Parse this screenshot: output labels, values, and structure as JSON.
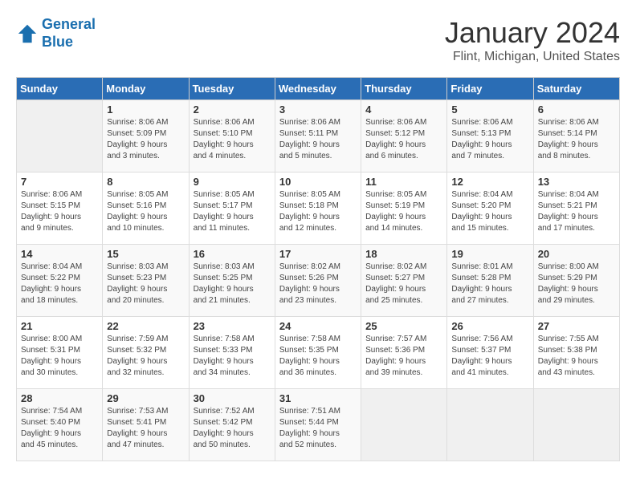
{
  "logo": {
    "text_general": "General",
    "text_blue": "Blue"
  },
  "header": {
    "title": "January 2024",
    "subtitle": "Flint, Michigan, United States"
  },
  "weekdays": [
    "Sunday",
    "Monday",
    "Tuesday",
    "Wednesday",
    "Thursday",
    "Friday",
    "Saturday"
  ],
  "weeks": [
    [
      {
        "day": "",
        "info": ""
      },
      {
        "day": "1",
        "info": "Sunrise: 8:06 AM\nSunset: 5:09 PM\nDaylight: 9 hours\nand 3 minutes."
      },
      {
        "day": "2",
        "info": "Sunrise: 8:06 AM\nSunset: 5:10 PM\nDaylight: 9 hours\nand 4 minutes."
      },
      {
        "day": "3",
        "info": "Sunrise: 8:06 AM\nSunset: 5:11 PM\nDaylight: 9 hours\nand 5 minutes."
      },
      {
        "day": "4",
        "info": "Sunrise: 8:06 AM\nSunset: 5:12 PM\nDaylight: 9 hours\nand 6 minutes."
      },
      {
        "day": "5",
        "info": "Sunrise: 8:06 AM\nSunset: 5:13 PM\nDaylight: 9 hours\nand 7 minutes."
      },
      {
        "day": "6",
        "info": "Sunrise: 8:06 AM\nSunset: 5:14 PM\nDaylight: 9 hours\nand 8 minutes."
      }
    ],
    [
      {
        "day": "7",
        "info": "Sunrise: 8:06 AM\nSunset: 5:15 PM\nDaylight: 9 hours\nand 9 minutes."
      },
      {
        "day": "8",
        "info": "Sunrise: 8:05 AM\nSunset: 5:16 PM\nDaylight: 9 hours\nand 10 minutes."
      },
      {
        "day": "9",
        "info": "Sunrise: 8:05 AM\nSunset: 5:17 PM\nDaylight: 9 hours\nand 11 minutes."
      },
      {
        "day": "10",
        "info": "Sunrise: 8:05 AM\nSunset: 5:18 PM\nDaylight: 9 hours\nand 12 minutes."
      },
      {
        "day": "11",
        "info": "Sunrise: 8:05 AM\nSunset: 5:19 PM\nDaylight: 9 hours\nand 14 minutes."
      },
      {
        "day": "12",
        "info": "Sunrise: 8:04 AM\nSunset: 5:20 PM\nDaylight: 9 hours\nand 15 minutes."
      },
      {
        "day": "13",
        "info": "Sunrise: 8:04 AM\nSunset: 5:21 PM\nDaylight: 9 hours\nand 17 minutes."
      }
    ],
    [
      {
        "day": "14",
        "info": "Sunrise: 8:04 AM\nSunset: 5:22 PM\nDaylight: 9 hours\nand 18 minutes."
      },
      {
        "day": "15",
        "info": "Sunrise: 8:03 AM\nSunset: 5:23 PM\nDaylight: 9 hours\nand 20 minutes."
      },
      {
        "day": "16",
        "info": "Sunrise: 8:03 AM\nSunset: 5:25 PM\nDaylight: 9 hours\nand 21 minutes."
      },
      {
        "day": "17",
        "info": "Sunrise: 8:02 AM\nSunset: 5:26 PM\nDaylight: 9 hours\nand 23 minutes."
      },
      {
        "day": "18",
        "info": "Sunrise: 8:02 AM\nSunset: 5:27 PM\nDaylight: 9 hours\nand 25 minutes."
      },
      {
        "day": "19",
        "info": "Sunrise: 8:01 AM\nSunset: 5:28 PM\nDaylight: 9 hours\nand 27 minutes."
      },
      {
        "day": "20",
        "info": "Sunrise: 8:00 AM\nSunset: 5:29 PM\nDaylight: 9 hours\nand 29 minutes."
      }
    ],
    [
      {
        "day": "21",
        "info": "Sunrise: 8:00 AM\nSunset: 5:31 PM\nDaylight: 9 hours\nand 30 minutes."
      },
      {
        "day": "22",
        "info": "Sunrise: 7:59 AM\nSunset: 5:32 PM\nDaylight: 9 hours\nand 32 minutes."
      },
      {
        "day": "23",
        "info": "Sunrise: 7:58 AM\nSunset: 5:33 PM\nDaylight: 9 hours\nand 34 minutes."
      },
      {
        "day": "24",
        "info": "Sunrise: 7:58 AM\nSunset: 5:35 PM\nDaylight: 9 hours\nand 36 minutes."
      },
      {
        "day": "25",
        "info": "Sunrise: 7:57 AM\nSunset: 5:36 PM\nDaylight: 9 hours\nand 39 minutes."
      },
      {
        "day": "26",
        "info": "Sunrise: 7:56 AM\nSunset: 5:37 PM\nDaylight: 9 hours\nand 41 minutes."
      },
      {
        "day": "27",
        "info": "Sunrise: 7:55 AM\nSunset: 5:38 PM\nDaylight: 9 hours\nand 43 minutes."
      }
    ],
    [
      {
        "day": "28",
        "info": "Sunrise: 7:54 AM\nSunset: 5:40 PM\nDaylight: 9 hours\nand 45 minutes."
      },
      {
        "day": "29",
        "info": "Sunrise: 7:53 AM\nSunset: 5:41 PM\nDaylight: 9 hours\nand 47 minutes."
      },
      {
        "day": "30",
        "info": "Sunrise: 7:52 AM\nSunset: 5:42 PM\nDaylight: 9 hours\nand 50 minutes."
      },
      {
        "day": "31",
        "info": "Sunrise: 7:51 AM\nSunset: 5:44 PM\nDaylight: 9 hours\nand 52 minutes."
      },
      {
        "day": "",
        "info": ""
      },
      {
        "day": "",
        "info": ""
      },
      {
        "day": "",
        "info": ""
      }
    ]
  ]
}
